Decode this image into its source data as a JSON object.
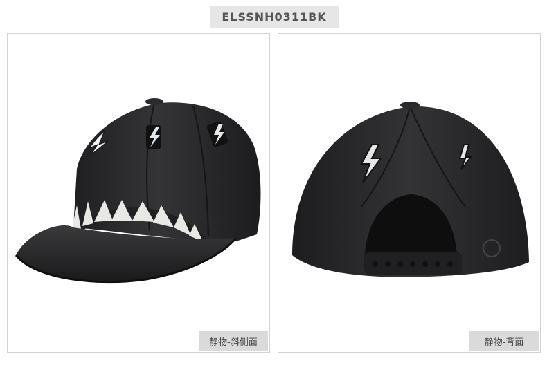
{
  "product": {
    "sku": "ELSSNH0311BK"
  },
  "views": [
    {
      "caption": "静物-斜侧面",
      "subject": "side-view-cap-photo"
    },
    {
      "caption": "静物-背面",
      "subject": "back-view-cap-photo"
    }
  ],
  "colors": {
    "cap": "#2b2b2d",
    "teeth": "#e8e8e4",
    "label_bg": "#e6e6e6"
  }
}
